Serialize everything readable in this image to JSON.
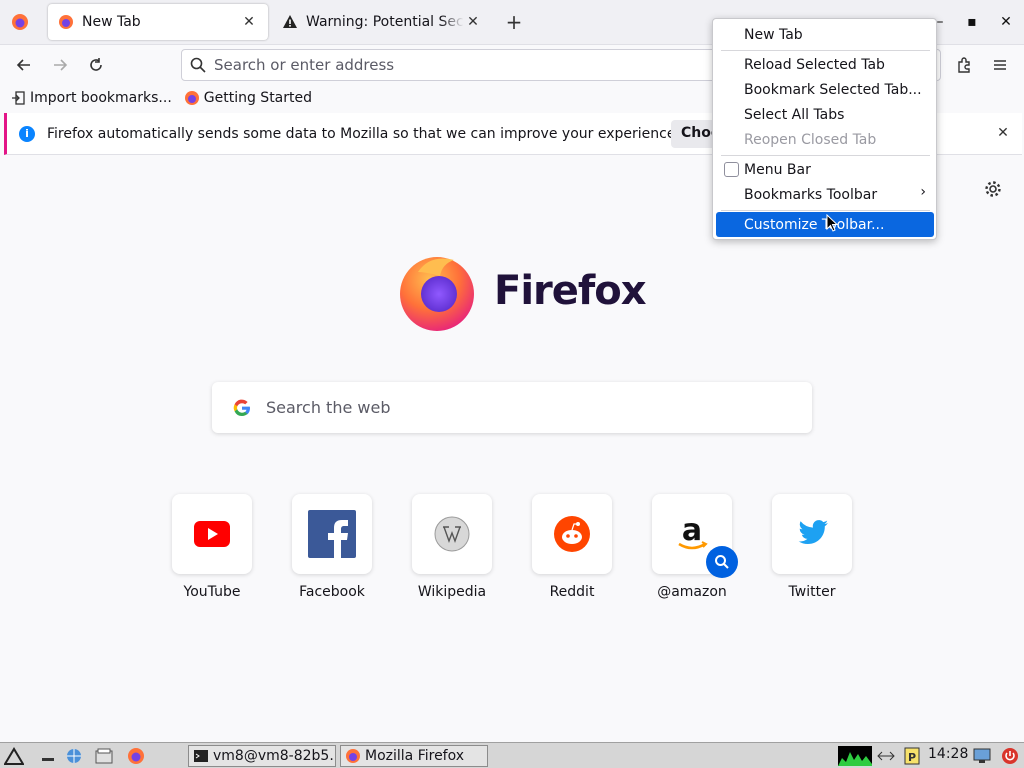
{
  "tabs": [
    {
      "title": "New Tab",
      "active": true
    },
    {
      "title": "Warning: Potential Security Risk Ahead",
      "active": false
    }
  ],
  "navbar": {
    "search_placeholder": "Search or enter address"
  },
  "bookmarks": [
    {
      "label": "Import bookmarks...",
      "icon": "import-icon"
    },
    {
      "label": "Getting Started",
      "icon": "firefox-icon"
    }
  ],
  "notification": {
    "text": "Firefox automatically sends some data to Mozilla so that we can improve your experience.",
    "button_label": "Choose What I Share"
  },
  "newtab": {
    "brand": "Firefox",
    "search_placeholder": "Search the web",
    "tiles": [
      {
        "label": "YouTube",
        "icon": "youtube-icon"
      },
      {
        "label": "Facebook",
        "icon": "facebook-icon"
      },
      {
        "label": "Wikipedia",
        "icon": "wikipedia-icon"
      },
      {
        "label": "Reddit",
        "icon": "reddit-icon"
      },
      {
        "label": "@amazon",
        "icon": "amazon-icon"
      },
      {
        "label": "Twitter",
        "icon": "twitter-icon"
      }
    ]
  },
  "context_menu": {
    "items": [
      {
        "label": "New Tab"
      },
      {
        "label": "Reload Selected Tab"
      },
      {
        "label": "Bookmark Selected Tab..."
      },
      {
        "label": "Select All Tabs"
      },
      {
        "label": "Reopen Closed Tab",
        "disabled": true
      },
      {
        "label": "Menu Bar",
        "checkbox": true,
        "checked": false
      },
      {
        "label": "Bookmarks Toolbar",
        "submenu": true
      },
      {
        "label": "Customize Toolbar...",
        "highlighted": true
      }
    ]
  },
  "taskbar": {
    "tasks": [
      {
        "label": "vm8@vm8-82b5..."
      },
      {
        "label": "Mozilla Firefox"
      }
    ],
    "clock": "14:28"
  },
  "colors": {
    "accent": "#0a67e0",
    "notification_border": "#e31587",
    "info": "#0a84ff"
  }
}
